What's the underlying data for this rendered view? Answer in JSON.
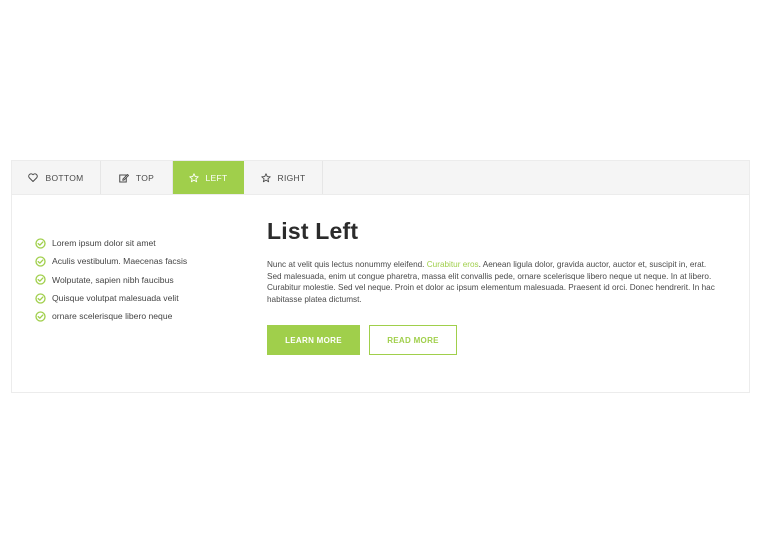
{
  "tabs": [
    {
      "label": "BOTTOM",
      "icon": "heart-icon",
      "active": false
    },
    {
      "label": "TOP",
      "icon": "edit-icon",
      "active": false
    },
    {
      "label": "LEFT",
      "icon": "star-icon",
      "active": true
    },
    {
      "label": "RIGHT",
      "icon": "star-icon",
      "active": false
    }
  ],
  "list_items": [
    "Lorem ipsum dolor sit amet",
    "Aculis vestibulum. Maecenas facsis",
    "Wolputate, sapien nibh faucibus",
    "Quisque volutpat malesuada velit",
    "ornare scelerisque libero neque"
  ],
  "panel": {
    "title": "List Left",
    "text_before": "Nunc at velit quis lectus nonummy eleifend. ",
    "text_highlight": "Curabitur eros",
    "text_after": ". Aenean ligula dolor, gravida auctor, auctor et, suscipit in, erat. Sed malesuada, enim ut congue pharetra, massa elit convallis pede, ornare scelerisque libero neque ut neque. In at libero. Curabitur molestie. Sed vel neque. Proin et dolor ac ipsum elementum malesuada. Praesent id orci. Donec hendrerit. In hac habitasse platea dictumst."
  },
  "buttons": {
    "learn_more": "LEARN MORE",
    "read_more": "READ MORE"
  },
  "colors": {
    "accent": "#a0cf4b",
    "tab_bar": "#f5f5f5",
    "text": "#4a4a4a",
    "heading": "#2b2b2b"
  }
}
